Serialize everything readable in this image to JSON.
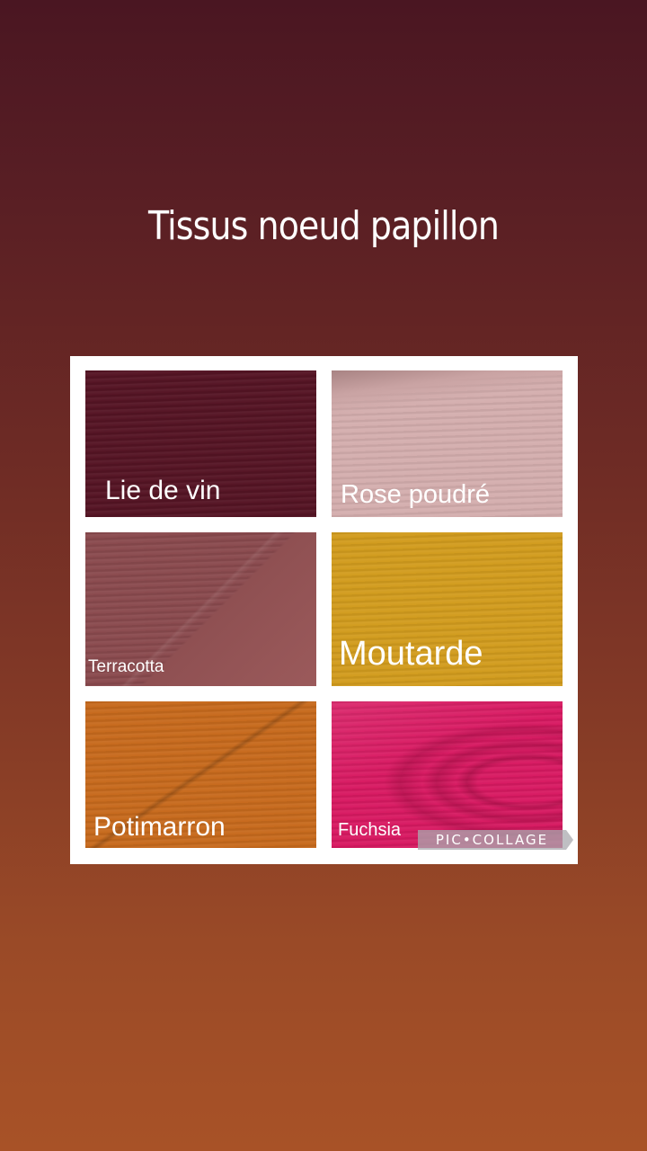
{
  "title": "Tissus noeud papillon",
  "swatches": [
    {
      "label": "Lie de vin",
      "color": "#551424"
    },
    {
      "label": "Rose poudré",
      "color": "#d4aeae"
    },
    {
      "label": "Terracotta",
      "color": "#8a4a4e"
    },
    {
      "label": "Moutarde",
      "color": "#d29c1e"
    },
    {
      "label": "Potimarron",
      "color": "#c76a1d"
    },
    {
      "label": "Fuchsia",
      "color": "#d81a62"
    }
  ],
  "watermark": "PIC•COLLAGE"
}
